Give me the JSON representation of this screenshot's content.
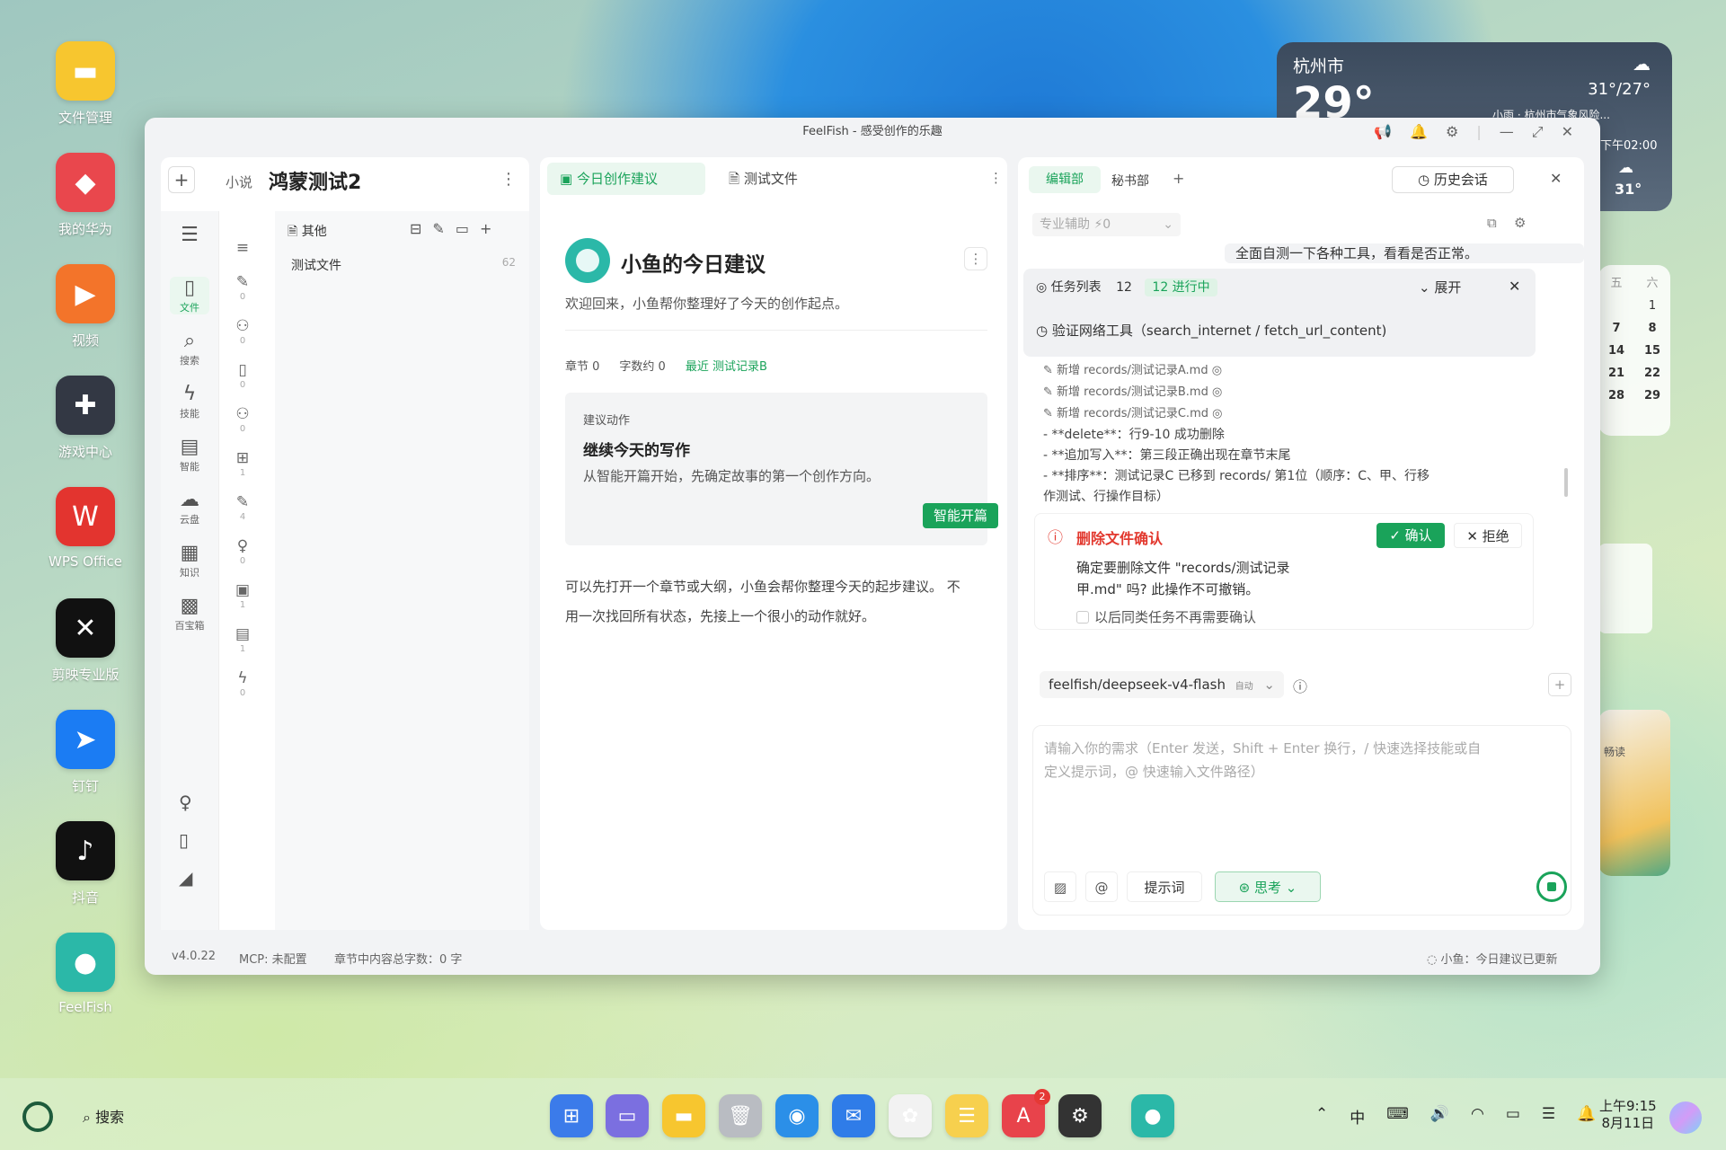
{
  "desktop": {
    "icons": [
      {
        "label": "文件管理",
        "glyph": "▬",
        "color": "#f7c62f"
      },
      {
        "label": "我的华为",
        "glyph": "◆",
        "color": "#e9474d"
      },
      {
        "label": "视频",
        "glyph": "▶",
        "color": "#f3742a"
      },
      {
        "label": "游戏中心",
        "glyph": "✚",
        "color": "#333844"
      },
      {
        "label": "WPS Office",
        "glyph": "W",
        "color": "#e3342f"
      },
      {
        "label": "剪映专业版",
        "glyph": "✕",
        "color": "#111111"
      },
      {
        "label": "钉钉",
        "glyph": "➤",
        "color": "#1b7cf3"
      },
      {
        "label": "抖音",
        "glyph": "♪",
        "color": "#111111"
      },
      {
        "label": "FeelFish",
        "glyph": "●",
        "color": "#2bb8a8"
      }
    ]
  },
  "weather": {
    "city": "杭州市",
    "temp": "29°",
    "range": "31°/27°",
    "alert": "小雨 · 杭州市气象风险...",
    "forecast_time": "下午02:00",
    "forecast_temp": "31°"
  },
  "calendar": {
    "rows": [
      [
        "五",
        "六"
      ],
      [
        "",
        "1"
      ],
      [
        "7",
        "8"
      ],
      [
        "14",
        "15"
      ],
      [
        "21",
        "22"
      ],
      [
        "28",
        "29"
      ]
    ]
  },
  "read_widget": {
    "label": "畅读"
  },
  "window": {
    "title": "FeelFish - 感受创作的乐趣",
    "left": {
      "add": "+",
      "category": "小说",
      "project": "鸿蒙测试2",
      "more": "⋮",
      "rail": [
        {
          "icon": "☰",
          "label": ""
        },
        {
          "icon": "▯",
          "label": "文件",
          "active": true
        },
        {
          "icon": "⌕",
          "label": "搜索"
        },
        {
          "icon": "ϟ",
          "label": "技能"
        },
        {
          "icon": "▤",
          "label": "智能"
        },
        {
          "icon": "☁",
          "label": "云盘"
        },
        {
          "icon": "▦",
          "label": "知识"
        },
        {
          "icon": "▩",
          "label": "百宝箱"
        }
      ],
      "rail_bottom": [
        "♀",
        "▯",
        "◢"
      ],
      "rail2": [
        {
          "icon": "≡",
          "count": ""
        },
        {
          "icon": "✎",
          "count": "0"
        },
        {
          "icon": "⚇",
          "count": "0"
        },
        {
          "icon": "▯",
          "count": "0"
        },
        {
          "icon": "⚇",
          "count": "0"
        },
        {
          "icon": "⊞",
          "count": "1"
        },
        {
          "icon": "✎",
          "count": "4"
        },
        {
          "icon": "♀",
          "count": "0"
        },
        {
          "icon": "▣",
          "count": "1"
        },
        {
          "icon": "▤",
          "count": "1"
        },
        {
          "icon": "ϟ",
          "count": "0"
        }
      ],
      "folder": "其他",
      "file_name": "测试文件",
      "file_count": "62"
    },
    "middle": {
      "tab1": "今日创作建议",
      "tab2": "测试文件",
      "heading": "小鱼的今日建议",
      "welcome": "欢迎回来，小鱼帮你整理好了今天的创作起点。",
      "stat_chapters": "章节 0",
      "stat_words": "字数约 0",
      "stat_recent": "最近 测试记录B",
      "card_label": "建议动作",
      "card_title": "继续今天的写作",
      "card_desc": "从智能开篇开始，先确定故事的第一个创作方向。",
      "card_button": "智能开篇",
      "para1": "可以先打开一个章节或大纲，小鱼会帮你整理今天的起步建议。 不",
      "para2": "用一次找回所有状态，先接上一个很小的动作就好。"
    },
    "right": {
      "tab1": "编辑部",
      "tab2": "秘书部",
      "tab_add": "+",
      "history": "历史会话",
      "mode_select": "专业辅助 ⚡0",
      "user_msg": "全面自测一下各种工具，看看是否正常。",
      "tasks_label": "任务列表",
      "tasks_count": "12",
      "tasks_status": "12 进行中",
      "expand": "展开",
      "current_task": "验证网络工具（search_internet / fetch_url_content)",
      "log": [
        "新增 records/测试记录A.md",
        "新增 records/测试记录B.md",
        "新增 records/测试记录C.md"
      ],
      "log_lines": [
        "- **delete**：行9-10 成功删除",
        "- **追加写入**：第三段正确出现在章节末尾",
        "- **排序**：测试记录C 已移到 records/ 第1位（顺序：C、甲、行移",
        "作测试、行操作目标）"
      ],
      "confirm_title": "删除文件确认",
      "confirm_ok": "确认",
      "confirm_reject": "拒绝",
      "confirm_msg1": "确定要删除文件 \"records/测试记录",
      "confirm_msg2": "甲.md\" 吗? 此操作不可撤销。",
      "confirm_check": "以后同类任务不再需要确认",
      "model": "feelfish/deepseek-v4-flash",
      "model_tag": "自动",
      "input_placeholder1": "请输入你的需求（Enter 发送，Shift + Enter 换行，/ 快速选择技能或自",
      "input_placeholder2": "定义提示词，@ 快速输入文件路径）",
      "btn_prompt": "提示词",
      "btn_think": "思考",
      "btn_at": "@"
    },
    "status": {
      "version": "v4.0.22",
      "mcp": "MCP: 未配置",
      "words": "章节中内容总字数：0 字",
      "right": "小鱼：今日建议已更新"
    }
  },
  "taskbar": {
    "search": "搜索",
    "time": "上午9:15",
    "date": "8月11日",
    "badge": "2",
    "gallery": "App Gallery"
  }
}
